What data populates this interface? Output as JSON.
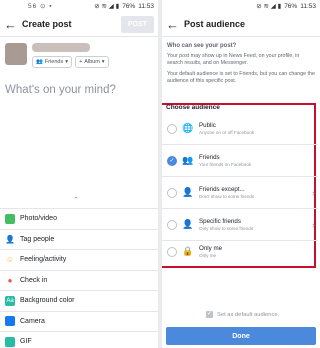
{
  "colors": {
    "accent": "#4a89dc",
    "highlight_border": "#c8102e",
    "text": "#1c1e21",
    "muted": "#8d949e"
  },
  "left": {
    "status": {
      "left": "56 ⊙ ▪",
      "icons": "⊘ ≋ ◢ ▮",
      "battery": "76%",
      "time": "11:53"
    },
    "title": "Create post",
    "post_label": "POST",
    "audience_chip": "Friends",
    "album_chip": "Album",
    "placeholder": "What's on your mind?",
    "options": [
      {
        "label": "Photo/video",
        "icon": "photo-icon",
        "color": "#45bd62"
      },
      {
        "label": "Tag people",
        "icon": "tag-people-icon",
        "color": "#1877f2"
      },
      {
        "label": "Feeling/activity",
        "icon": "feeling-icon",
        "color": "#f7b928"
      },
      {
        "label": "Check in",
        "icon": "check-in-icon",
        "color": "#f5533d"
      },
      {
        "label": "Background color",
        "icon": "background-color-icon",
        "color": "#2abba7"
      },
      {
        "label": "Camera",
        "icon": "camera-icon",
        "color": "#1877f2"
      },
      {
        "label": "GIF",
        "icon": "gif-icon",
        "color": "#2abba7"
      }
    ]
  },
  "right": {
    "status": {
      "icons": "⊘ ≋ ◢ ▮",
      "battery": "76%",
      "time": "11:53"
    },
    "title": "Post audience",
    "question": "Who can see your post?",
    "desc1": "Your post may show up in News Feed, on your profile, in search results, and on Messenger.",
    "desc2": "Your default audience is set to Friends, but you can change the audience of this specific post.",
    "choose_title": "Choose audience",
    "audiences": [
      {
        "label": "Public",
        "sub": "Anyone on or off Facebook",
        "icon": "globe-icon",
        "selected": false,
        "chevron": false
      },
      {
        "label": "Friends",
        "sub": "Your friends on Facebook",
        "icon": "friends-icon",
        "selected": true,
        "chevron": false
      },
      {
        "label": "Friends except...",
        "sub": "Don't show to some friends",
        "icon": "friends-except-icon",
        "selected": false,
        "chevron": true
      },
      {
        "label": "Specific friends",
        "sub": "Only show to some friends",
        "icon": "specific-friends-icon",
        "selected": false,
        "chevron": true
      },
      {
        "label": "Only me",
        "sub": "Only me",
        "icon": "lock-icon",
        "selected": false,
        "chevron": false
      }
    ],
    "default_label": "Set as default audience.",
    "done_label": "Done"
  }
}
